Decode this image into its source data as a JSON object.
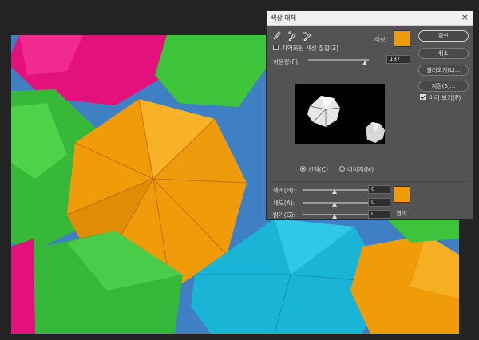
{
  "dialog": {
    "title": "색상 대체",
    "close_icon": "×",
    "color_label": "색상:",
    "color_swatch": "#f09c0a",
    "eyedropper_icons": [
      "eyedropper-icon",
      "eyedropper-plus-icon",
      "eyedropper-minus-icon"
    ],
    "localized_clusters_label": "지역화된 색상 집합(Z)",
    "localized_clusters_checked": false,
    "fuzziness_label": "허용량(F):",
    "fuzziness_value": "187",
    "fuzziness_level": 0.93,
    "view_selection_label": "선택(C)",
    "view_image_label": "이미지(M)",
    "view_mode": "selection",
    "hue_label": "색조(H):",
    "hue_value": "0",
    "saturation_label": "채도(A):",
    "saturation_value": "0",
    "lightness_label": "밝기(G):",
    "lightness_value": "0",
    "result_label": "결과",
    "result_swatch": "#f09c0a",
    "buttons": {
      "ok": "확인",
      "cancel": "취소",
      "load": "불러오기(L)...",
      "save": "저장(S)..."
    },
    "preview_label": "미리 보기(P)",
    "preview_checked": true
  },
  "colors": {
    "workspace_bg": "#232323",
    "sky_blue": "#3f7fc4",
    "umbrella_orange": "#f09c0a",
    "umbrella_green": "#3ec43a",
    "umbrella_magenta": "#e3117c",
    "umbrella_cyan": "#1ab4d6"
  }
}
